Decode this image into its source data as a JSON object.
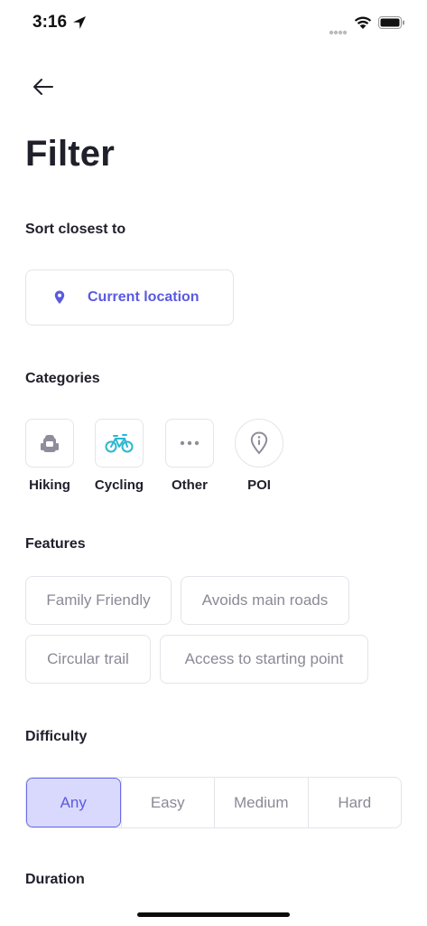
{
  "status_bar": {
    "time": "3:16"
  },
  "page": {
    "title": "Filter"
  },
  "sort": {
    "label": "Sort closest to",
    "location_button": "Current location",
    "accent": "#5a5ae0"
  },
  "categories": {
    "label": "Categories",
    "items": [
      {
        "label": "Hiking",
        "icon": "backpack-icon"
      },
      {
        "label": "Cycling",
        "icon": "bicycle-icon"
      },
      {
        "label": "Other",
        "icon": "more-dots-icon"
      },
      {
        "label": "POI",
        "icon": "info-pin-icon"
      }
    ]
  },
  "features": {
    "label": "Features",
    "items": [
      "Family Friendly",
      "Avoids main roads",
      "Circular trail",
      "Access to starting point"
    ]
  },
  "difficulty": {
    "label": "Difficulty",
    "options": [
      "Any",
      "Easy",
      "Medium",
      "Hard"
    ],
    "selected": "Any"
  },
  "duration": {
    "label": "Duration"
  }
}
